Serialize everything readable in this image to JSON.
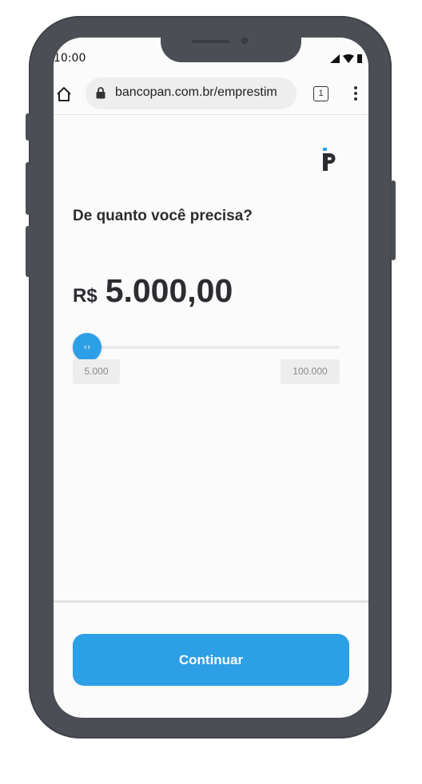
{
  "status_bar": {
    "time": "10:00",
    "icons": [
      "signal-icon",
      "wifi-icon",
      "battery-icon"
    ]
  },
  "browser": {
    "url": "bancopan.com.br/emprestim",
    "tab_count": "1",
    "icons": [
      "home-icon",
      "lock-icon",
      "tabs-icon",
      "menu-icon"
    ]
  },
  "page": {
    "logo_icon": "pan-logo-icon",
    "question": "De quanto você precisa?",
    "amount": {
      "currency": "R$",
      "value": "5.000,00"
    },
    "slider": {
      "min_label": "5.000",
      "max_label": "100.000",
      "thumb_glyph": "‹›",
      "level": 0
    },
    "continue_label": "Continuar"
  },
  "colors": {
    "accent": "#2c9fe6",
    "frame": "#4b4f55",
    "text": "#2c2d31"
  }
}
